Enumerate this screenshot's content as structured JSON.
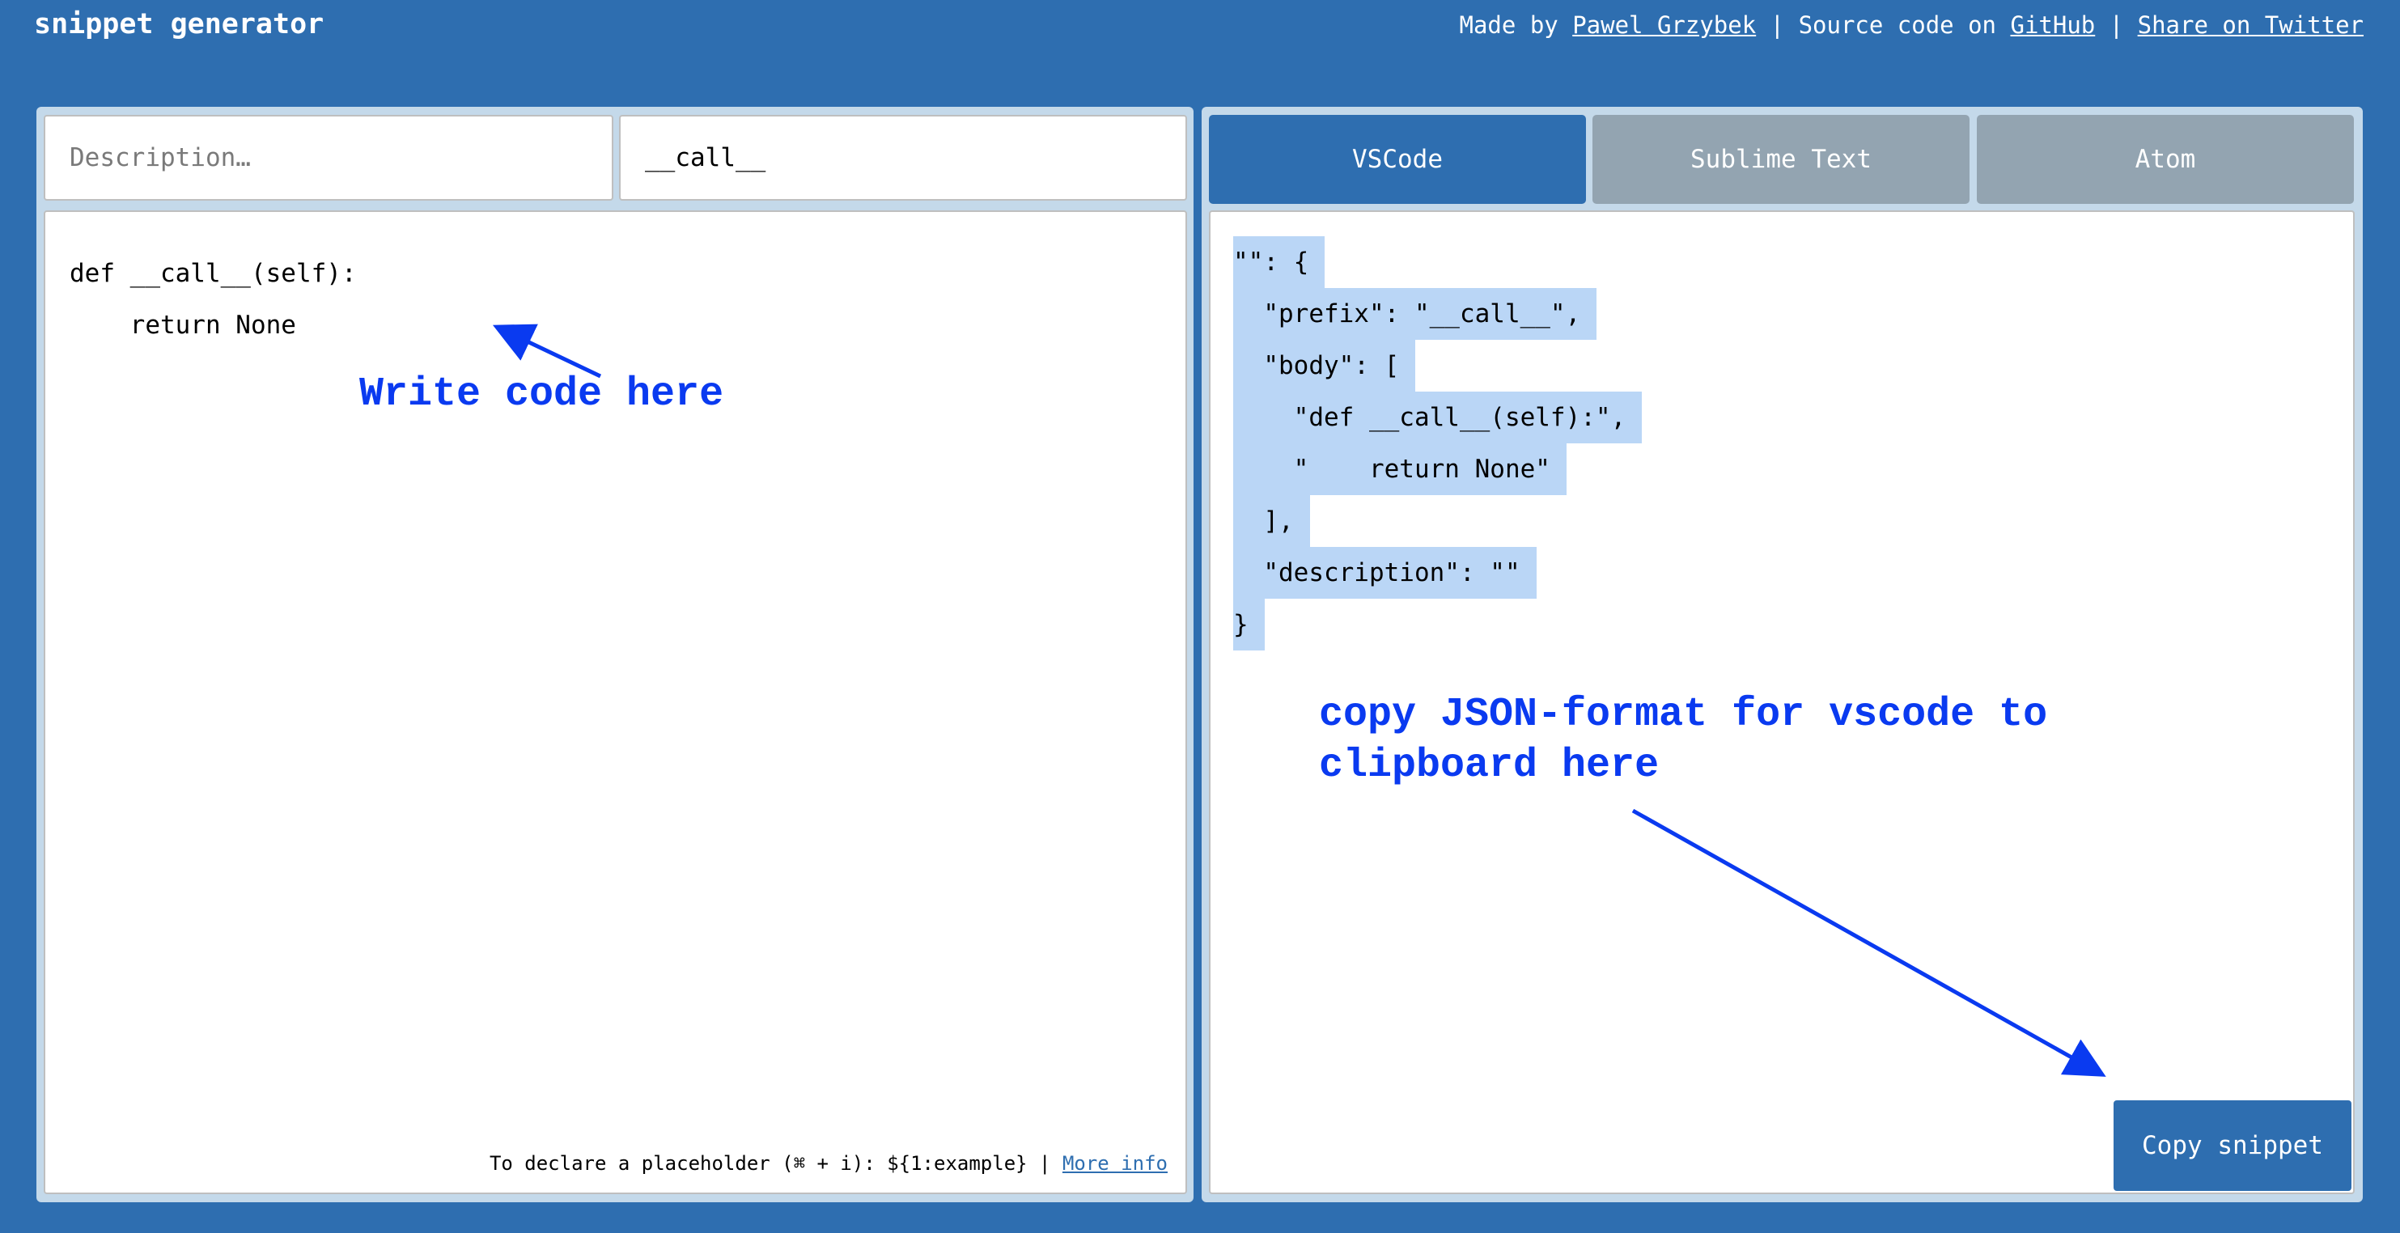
{
  "header": {
    "title": "snippet generator",
    "made_by_prefix": "Made by ",
    "author_link": "Pawel Grzybek",
    "separator": " | ",
    "source_prefix": "Source code on ",
    "github_link": "GitHub",
    "twitter_link": "Share on Twitter"
  },
  "editor": {
    "description_placeholder": "Description…",
    "description_value": "",
    "prefix_value": "__call__",
    "code": "def __call__(self):\n    return None",
    "hint_text": "To declare a placeholder (⌘ + i): ${1:example} | ",
    "more_info_link": "More info"
  },
  "output": {
    "tabs": [
      {
        "label": "VSCode",
        "active": true
      },
      {
        "label": "Sublime Text",
        "active": false
      },
      {
        "label": "Atom",
        "active": false
      }
    ],
    "json_lines": [
      "\"\": {",
      "  \"prefix\": \"__call__\",",
      "  \"body\": [",
      "    \"def __call__(self):\",",
      "    \"    return None\"",
      "  ],",
      "  \"description\": \"\"",
      "}"
    ],
    "copy_button": "Copy snippet"
  },
  "annotations": {
    "left": "Write code here",
    "right": "copy JSON-format for vscode to\nclipboard here",
    "color": "#0a3af0"
  },
  "colors": {
    "background": "#2e6eb0",
    "panel": "#c4d9ea",
    "tab_active": "#2e6eb0",
    "tab_inactive": "#93a4b1",
    "selection": "#bad6f6"
  }
}
